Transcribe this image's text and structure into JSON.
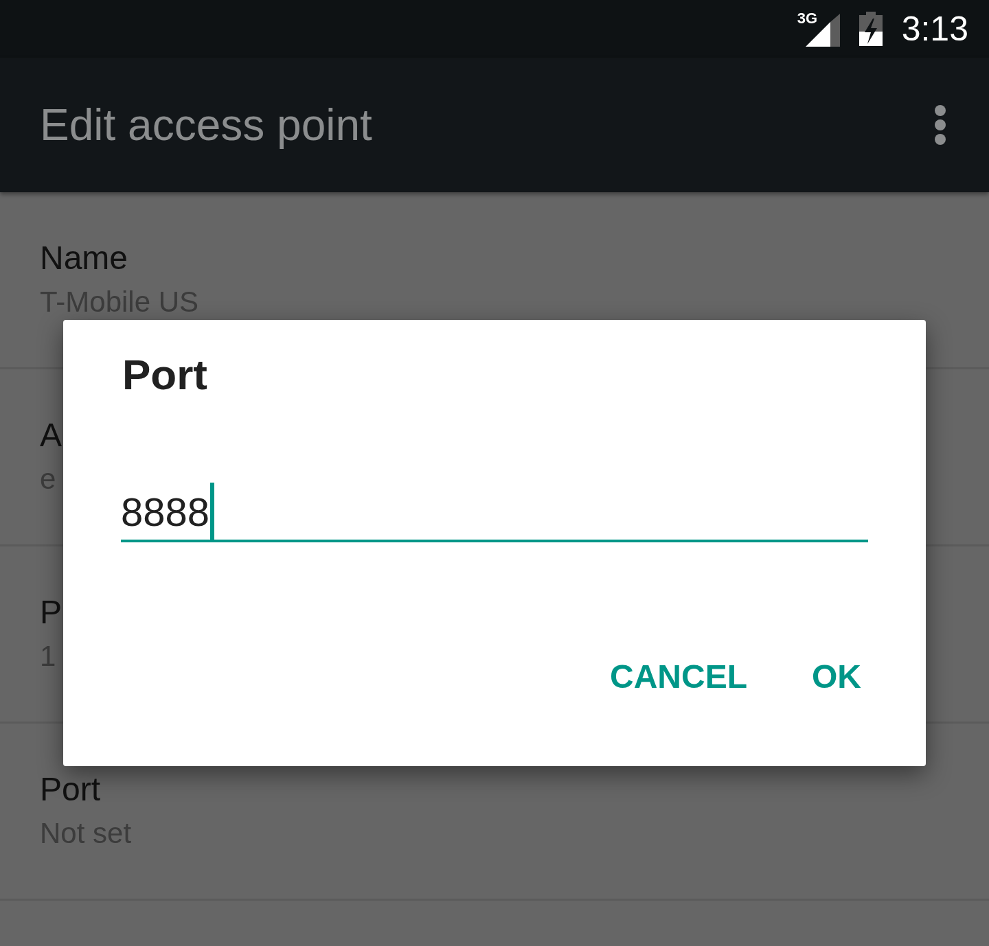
{
  "status_bar": {
    "network": "3G",
    "time": "3:13"
  },
  "app_bar": {
    "title": "Edit access point"
  },
  "settings": [
    {
      "title": "Name",
      "value": "T-Mobile US"
    },
    {
      "title": "A",
      "value": "e"
    },
    {
      "title": "P",
      "value": "1"
    },
    {
      "title": "Port",
      "value": "Not set"
    }
  ],
  "dialog": {
    "title": "Port",
    "input": {
      "value": "8888",
      "focused": true
    },
    "buttons": [
      "CANCEL",
      "OK"
    ]
  }
}
